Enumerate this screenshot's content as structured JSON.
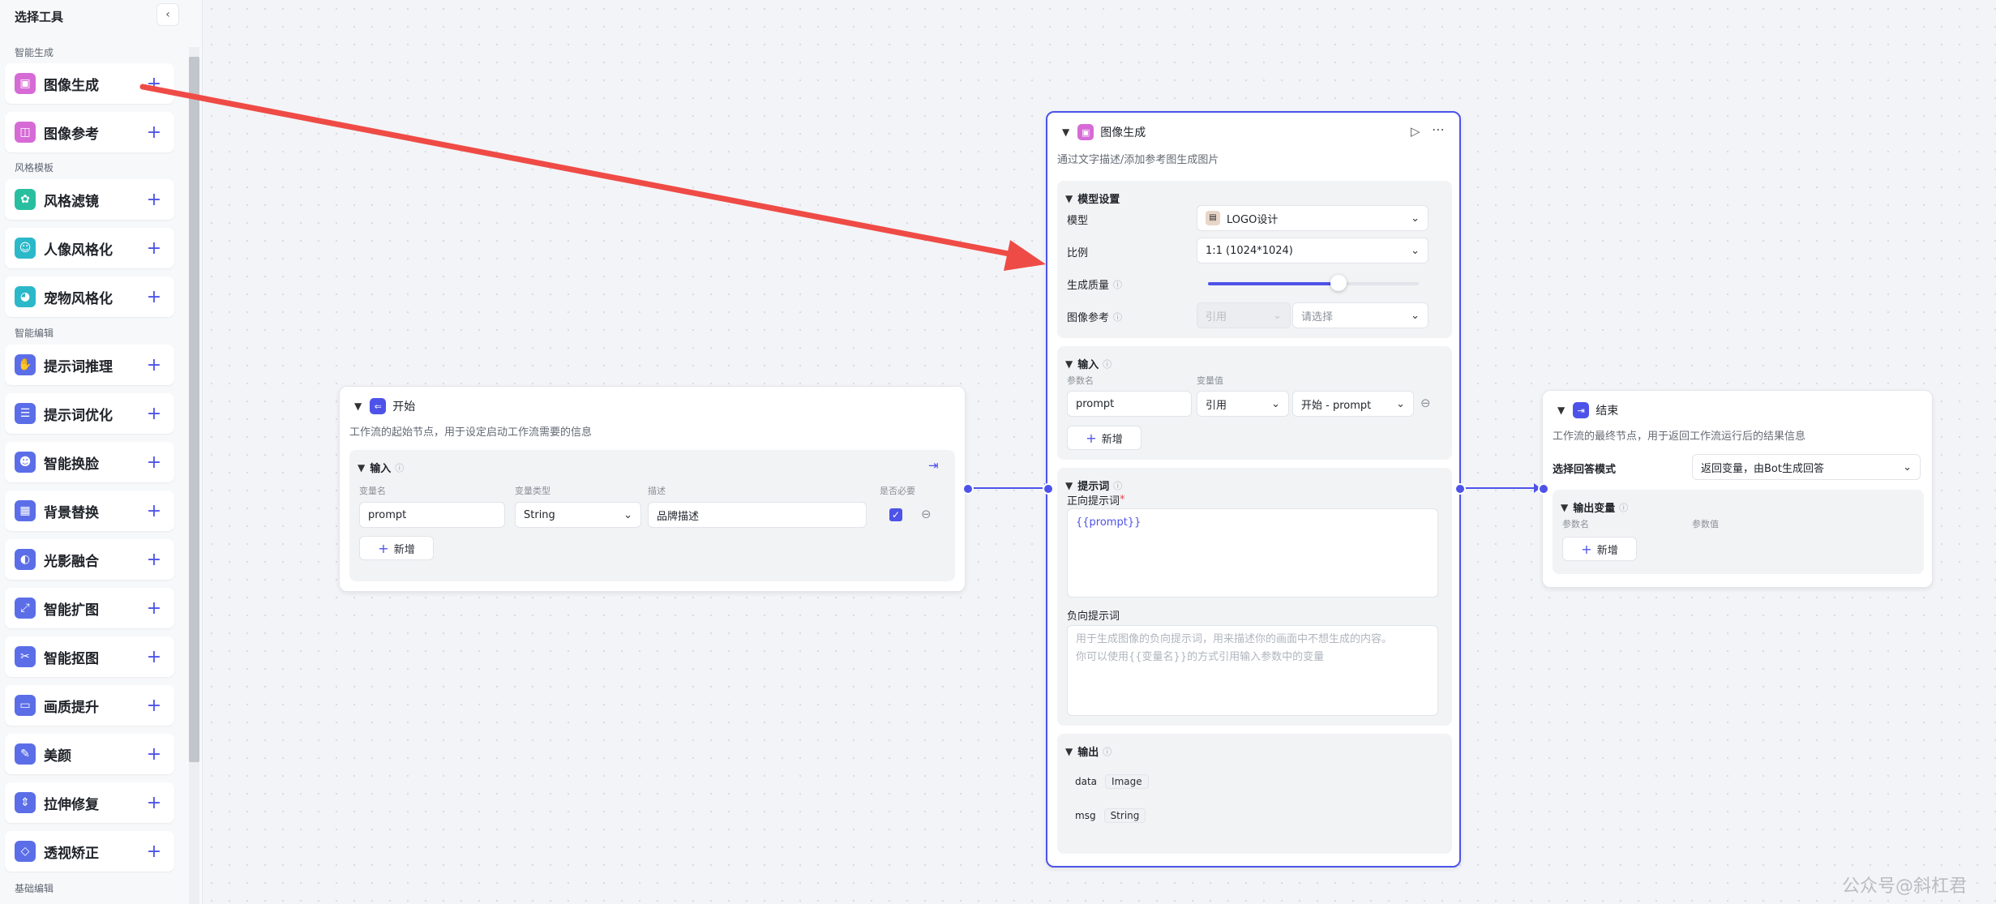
{
  "sidebar": {
    "title": "选择工具",
    "sections": [
      {
        "label": "智能生成"
      },
      {
        "label": "风格模板"
      },
      {
        "label": "智能编辑"
      },
      {
        "label": "基础编辑"
      }
    ],
    "tools": [
      {
        "label": "图像生成",
        "color": "#d66bd6"
      },
      {
        "label": "图像参考",
        "color": "#d66bd6"
      },
      {
        "label": "风格滤镜",
        "color": "#27bfa0"
      },
      {
        "label": "人像风格化",
        "color": "#2bb8c9"
      },
      {
        "label": "宠物风格化",
        "color": "#2bb8c9"
      },
      {
        "label": "提示词推理",
        "color": "#5b6ee8"
      },
      {
        "label": "提示词优化",
        "color": "#5b6ee8"
      },
      {
        "label": "智能换脸",
        "color": "#5b6ee8"
      },
      {
        "label": "背景替换",
        "color": "#5b6ee8"
      },
      {
        "label": "光影融合",
        "color": "#5b6ee8"
      },
      {
        "label": "智能扩图",
        "color": "#5b6ee8"
      },
      {
        "label": "智能抠图",
        "color": "#5b6ee8"
      },
      {
        "label": "画质提升",
        "color": "#5b6ee8"
      },
      {
        "label": "美颜",
        "color": "#5b6ee8"
      },
      {
        "label": "拉伸修复",
        "color": "#5b6ee8"
      },
      {
        "label": "透视矫正",
        "color": "#5b6ee8"
      }
    ],
    "plus": "+"
  },
  "start_node": {
    "title": "开始",
    "desc": "工作流的起始节点，用于设定启动工作流需要的信息",
    "input_title": "输入",
    "col_name": "变量名",
    "col_type": "变量类型",
    "col_desc": "描述",
    "col_required": "是否必要",
    "var_name": "prompt",
    "var_type": "String",
    "var_desc": "品牌描述",
    "add_label": "新增"
  },
  "image_node": {
    "title": "图像生成",
    "desc": "通过文字描述/添加参考图生成图片",
    "model_settings": "模型设置",
    "model_label": "模型",
    "model_value": "LOGO设计",
    "ratio_label": "比例",
    "ratio_value": "1:1 (1024*1024)",
    "quality_label": "生成质量",
    "quality_level": 0.62,
    "ref_label": "图像参考",
    "ref_mode": "引用",
    "ref_placeholder": "请选择",
    "input_title": "输入",
    "param_name_lbl": "参数名",
    "var_value_lbl": "变量值",
    "param_name": "prompt",
    "param_mode": "引用",
    "param_ref": "开始 - prompt",
    "add_label": "新增",
    "prompt_title": "提示词",
    "positive_label": "正向提示词",
    "positive_value": "{{prompt}}",
    "negative_label": "负向提示词",
    "negative_placeholder_1": "用于生成图像的负向提示词，用来描述你的画面中不想生成的内容。",
    "negative_placeholder_2": "你可以使用{{变量名}}的方式引用输入参数中的变量",
    "output_title": "输出",
    "out_1_name": "data",
    "out_1_type": "Image",
    "out_2_name": "msg",
    "out_2_type": "String"
  },
  "end_node": {
    "title": "结束",
    "desc": "工作流的最终节点，用于返回工作流运行后的结果信息",
    "mode_label": "选择回答模式",
    "mode_value": "返回变量，由Bot生成回答",
    "output_title": "输出变量",
    "param_name_lbl": "参数名",
    "param_value_lbl": "参数值",
    "add_label": "新增"
  },
  "watermark": "公众号@斜杠君",
  "colors": {
    "accent": "#4d53e8",
    "arrow": "#ef4b46"
  }
}
